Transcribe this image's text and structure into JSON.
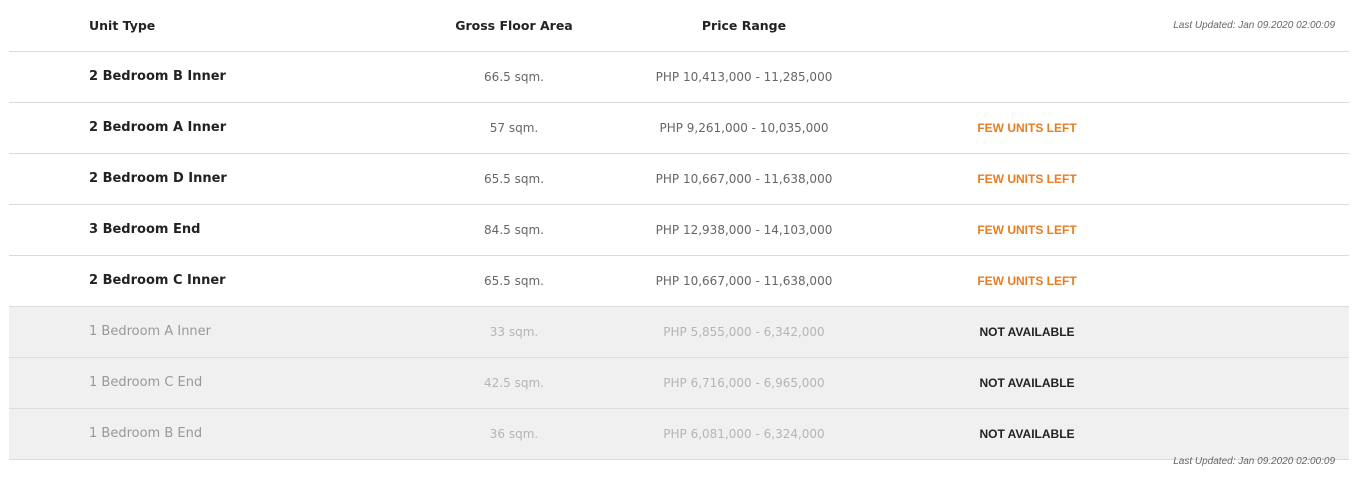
{
  "header": {
    "unit_type": "Unit Type",
    "gross_floor_area": "Gross Floor Area",
    "price_range": "Price Range",
    "last_updated": "Last Updated: Jan 09.2020 02:00:09"
  },
  "rows": [
    {
      "unit_type": "2 Bedroom B Inner",
      "area": "66.5 sqm.",
      "price": "PHP 10,413,000 - 11,285,000",
      "status": ""
    },
    {
      "unit_type": "2 Bedroom A Inner",
      "area": "57 sqm.",
      "price": "PHP 9,261,000 - 10,035,000",
      "status": "FEW UNITS LEFT"
    },
    {
      "unit_type": "2 Bedroom D Inner",
      "area": "65.5 sqm.",
      "price": "PHP 10,667,000 - 11,638,000",
      "status": "FEW UNITS LEFT"
    },
    {
      "unit_type": "3 Bedroom End",
      "area": "84.5 sqm.",
      "price": "PHP 12,938,000 - 14,103,000",
      "status": "FEW UNITS LEFT"
    },
    {
      "unit_type": "2 Bedroom C Inner",
      "area": "65.5 sqm.",
      "price": "PHP 10,667,000 - 11,638,000",
      "status": "FEW UNITS LEFT"
    },
    {
      "unit_type": "1 Bedroom A Inner",
      "area": "33 sqm.",
      "price": "PHP 5,855,000 - 6,342,000",
      "status": "NOT AVAILABLE"
    },
    {
      "unit_type": "1 Bedroom C End",
      "area": "42.5 sqm.",
      "price": "PHP 6,716,000 - 6,965,000",
      "status": "NOT AVAILABLE"
    },
    {
      "unit_type": "1 Bedroom B End",
      "area": "36 sqm.",
      "price": "PHP 6,081,000 - 6,324,000",
      "status": "NOT AVAILABLE"
    }
  ],
  "footer": {
    "last_updated": "Last Updated: Jan 09.2020 02:00:09"
  },
  "colors": {
    "few_units": "#e67e22",
    "not_available": "#222222",
    "unavailable_row_bg": "#f0f0f0",
    "border": "#dcdcdc"
  }
}
